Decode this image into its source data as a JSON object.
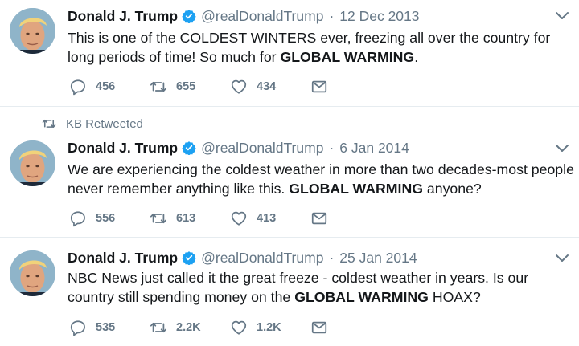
{
  "tweets": [
    {
      "retweeted_by": "",
      "author_name": "Donald J. Trump",
      "handle": "@realDonaldTrump",
      "separator": "·",
      "date": "12 Dec 2013",
      "text_parts": [
        "This is one of the COLDEST WINTERS ever, freezing all over the country for long periods of time! So much for ",
        "GLOBAL WARMING",
        "."
      ],
      "replies": "456",
      "retweets": "655",
      "likes": "434"
    },
    {
      "retweeted_by": "KB Retweeted",
      "author_name": "Donald J. Trump",
      "handle": "@realDonaldTrump",
      "separator": "·",
      "date": "6 Jan 2014",
      "text_parts": [
        "We are experiencing the coldest weather in more than two decades-most people never remember anything like this. ",
        "GLOBAL WARMING",
        " anyone?"
      ],
      "replies": "556",
      "retweets": "613",
      "likes": "413"
    },
    {
      "retweeted_by": "",
      "author_name": "Donald J. Trump",
      "handle": "@realDonaldTrump",
      "separator": "·",
      "date": "25 Jan 2014",
      "text_parts": [
        "NBC News just called it the great freeze - coldest weather in years. Is our country still spending money on the ",
        "GLOBAL WARMING",
        " HOAX?"
      ],
      "replies": "535",
      "retweets": "2.2K",
      "likes": "1.2K"
    }
  ],
  "colors": {
    "verified": "#1da1f2",
    "muted": "#657786",
    "divider": "#e6ecf0"
  },
  "icons": [
    "retweet-icon",
    "verified-badge-icon",
    "chevron-down-icon",
    "reply-icon",
    "like-icon",
    "direct-message-icon"
  ]
}
